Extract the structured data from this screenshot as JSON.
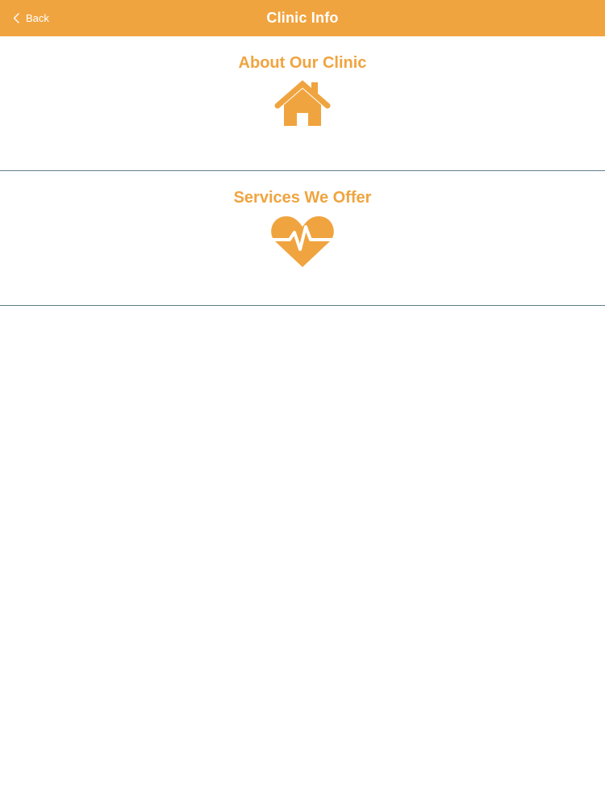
{
  "navbar": {
    "back_label": "Back",
    "title": "Clinic Info",
    "background_color": "#F0A43F"
  },
  "sections": [
    {
      "title": "About Our Clinic",
      "icon": "house-icon"
    },
    {
      "title": "Services We Offer",
      "icon": "heart-pulse-icon"
    }
  ],
  "colors": {
    "accent": "#F0A43F",
    "divider": "#5E7F8C",
    "background": "#FFFFFF"
  }
}
